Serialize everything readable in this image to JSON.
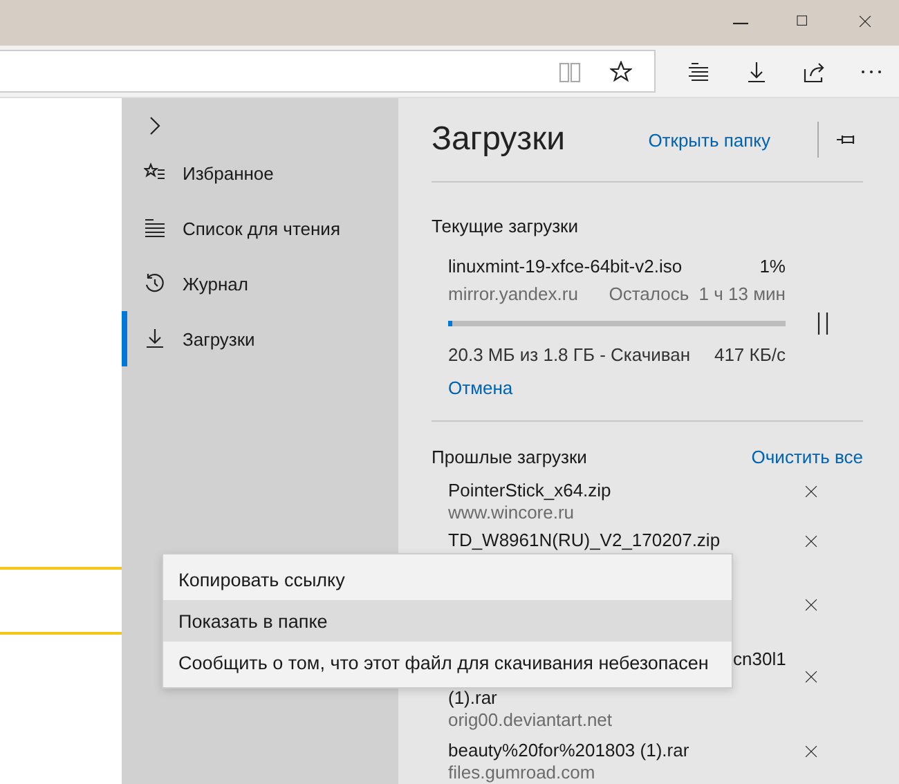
{
  "hub_nav": [
    {
      "label": "Избранное",
      "selected": false
    },
    {
      "label": "Список для чтения",
      "selected": false
    },
    {
      "label": "Журнал",
      "selected": false
    },
    {
      "label": "Загрузки",
      "selected": true
    }
  ],
  "panel": {
    "title": "Загрузки",
    "open_folder": "Открыть папку"
  },
  "current": {
    "heading": "Текущие загрузки",
    "file": "linuxmint-19-xfce-64bit-v2.iso",
    "percent": "1%",
    "source": "mirror.yandex.ru",
    "remaining": "Осталось  1 ч 13 мин",
    "level": 0.01,
    "size": "20.3 МБ из 1.8 ГБ - Скачиван",
    "speed": "417 КБ/с",
    "cancel": "Отмена"
  },
  "past": {
    "heading": "Прошлые загрузки",
    "clear": "Очистить все",
    "items": [
      {
        "kind": "file",
        "name_lines": [
          "PointerStick_x64.zip"
        ],
        "source": "www.wincore.ru"
      },
      {
        "kind": "file",
        "name_lines": [
          "TD_W8961N(RU)_V2_170207.zip"
        ]
      },
      {
        "kind": "covered"
      },
      {
        "kind": "file",
        "name_lines": [
          "cn30l1",
          "(1).rar"
        ],
        "source": "orig00.deviantart.net"
      },
      {
        "kind": "file",
        "name_lines": [
          "beauty%20for%201803 (1).rar"
        ],
        "source": "files.gumroad.com"
      }
    ]
  },
  "context_menu": [
    {
      "label": "Копировать ссылку",
      "selected": false
    },
    {
      "label": "Показать в папке",
      "selected": true
    },
    {
      "label": "Сообщить о том, что этот файл для скачивания небезопасен",
      "selected": false
    }
  ]
}
